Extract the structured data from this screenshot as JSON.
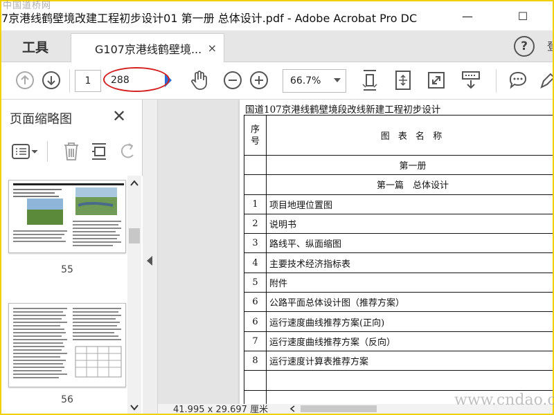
{
  "window": {
    "title": "7京港线鹤壁境改建工程初步设计01 第一册 总体设计.pdf - Adobe Acrobat Pro DC",
    "minimize_glyph": "—",
    "maximize_glyph": "☐"
  },
  "tabs": {
    "tools_label": "工具",
    "document_label": "G107京港线鹤壁境...",
    "close_glyph": "×",
    "help_glyph": "?",
    "signin_glyph": "登"
  },
  "toolbar": {
    "current_page": "1",
    "total_pages": "288",
    "zoom": "66.7%",
    "icons": [
      "arrow-up-icon",
      "arrow-down-icon",
      "cursor-icon",
      "hand-icon",
      "zoom-out-icon",
      "zoom-in-icon",
      "fit-height-icon",
      "fit-page-icon",
      "fullscreen-icon",
      "scroll-mode-icon",
      "comment-icon",
      "pen-icon"
    ]
  },
  "sidepanel": {
    "title": "页面缩略图",
    "close_glyph": "✕",
    "thumbnails": [
      {
        "label": "55"
      },
      {
        "label": "56"
      }
    ]
  },
  "document": {
    "heading": "国道107京港线鹤壁境段改线新建工程初步设计",
    "header_num": "序\n号",
    "header_name": "图 表 名 称",
    "volume": "第一册",
    "part": "第一篇　总体设计",
    "rows": [
      {
        "num": "1",
        "name": "项目地理位置图"
      },
      {
        "num": "2",
        "name": "说明书"
      },
      {
        "num": "3",
        "name": "路线平、纵面缩图"
      },
      {
        "num": "4",
        "name": "主要技术经济指标表"
      },
      {
        "num": "5",
        "name": "附件"
      },
      {
        "num": "6",
        "name": "公路平面总体设计图（推荐方案）"
      },
      {
        "num": "6",
        "name": "运行速度曲线推荐方案(正向)"
      },
      {
        "num": "7",
        "name": "运行速度曲线推荐方案（反向）"
      },
      {
        "num": "8",
        "name": "运行速度计算表推荐方案"
      }
    ]
  },
  "status": {
    "dimensions": "41.995 x 29.697 厘米"
  },
  "watermarks": {
    "top": "中国道桥网",
    "bottom": "www.cndao.com"
  },
  "colors": {
    "frame": "#f0d000",
    "annotation": "#d41f1f",
    "link_blue": "#2b6cd4"
  }
}
